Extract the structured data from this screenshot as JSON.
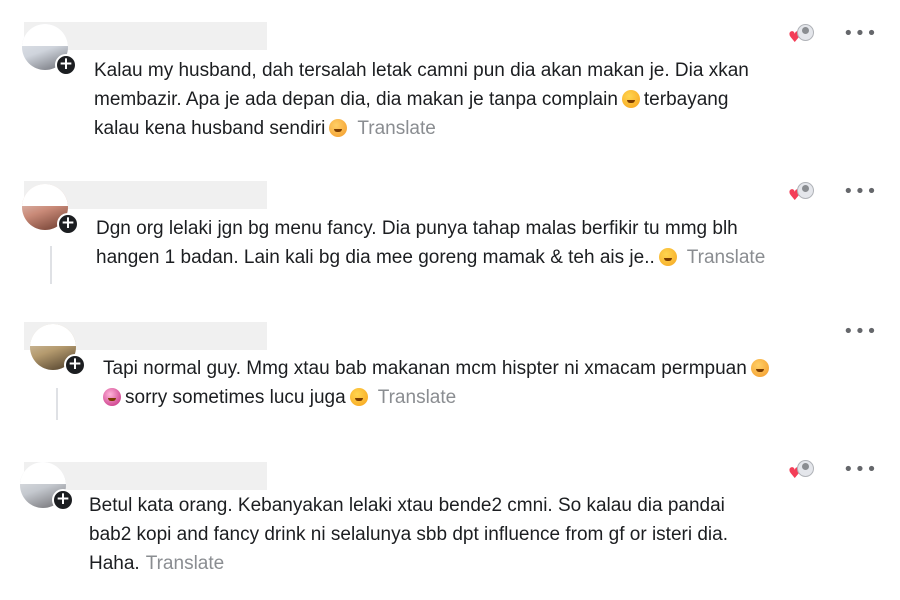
{
  "comments": [
    {
      "lines": [
        "Kalau my husband, dah tersalah letak camni pun dia akan makan je. Dia xkan",
        "membazir. Apa je ada depan dia, dia makan je tanpa complain",
        "terbayang",
        "kalau kena husband sendiri"
      ],
      "translate": "Translate",
      "emojis": [
        "smiling-face-with-sweat-icon",
        "face-with-hand-over-mouth-icon"
      ]
    },
    {
      "lines": [
        "Dgn org lelaki jgn bg menu fancy. Dia punya tahap malas berfikir tu mmg blh",
        "hangen 1 badan. Lain kali bg dia mee goreng mamak & teh ais je.."
      ],
      "translate": "Translate",
      "emojis": [
        "grimacing-face-icon"
      ]
    },
    {
      "lines": [
        "Tapi normal guy. Mmg xtau bab makanan mcm hispter ni xmacam permpuan",
        "sorry sometimes lucu juga"
      ],
      "translate": "Translate",
      "emojis": [
        "face-with-hand-over-mouth-icon",
        "rolling-on-floor-laughing-icon",
        "smiling-face-with-sweat-icon"
      ]
    },
    {
      "lines": [
        "Betul kata orang. Kebanyakan lelaki xtau bende2 cmni. So kalau dia pandai",
        "bab2 kopi and fancy drink ni selalunya sbb dpt influence from gf or isteri dia.",
        "Haha."
      ],
      "translate": "Translate",
      "emojis": []
    }
  ],
  "icons": {
    "more": "•••",
    "heart": "♥",
    "plus": "+"
  },
  "colors": {
    "text": "#1c1e21",
    "translate": "#8a8d91",
    "heart": "#f33e58",
    "redaction": "#f0f0f0"
  }
}
